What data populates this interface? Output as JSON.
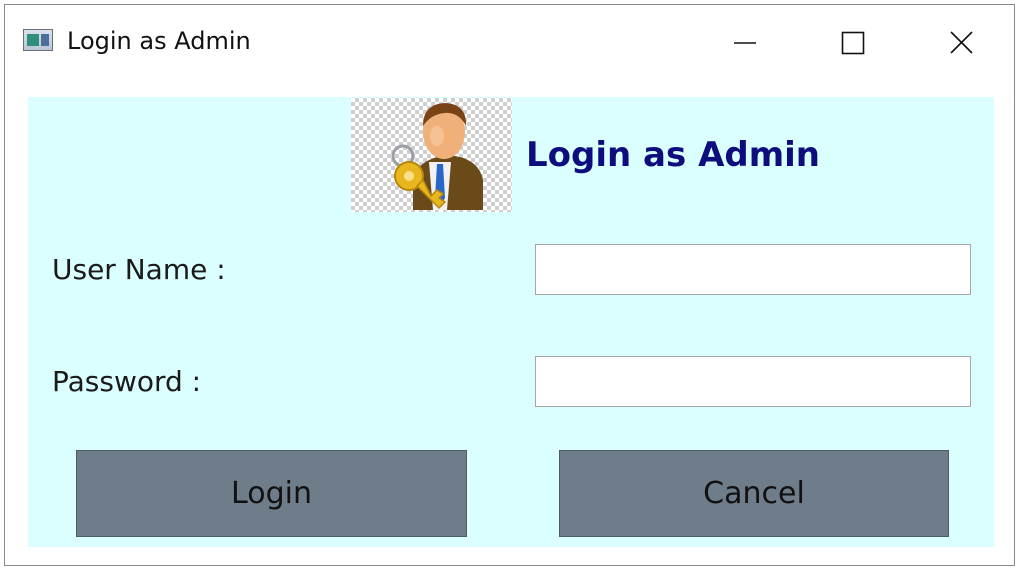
{
  "window": {
    "title": "Login as Admin",
    "icon": "app-window-icon",
    "controls": {
      "minimize": "minimize-icon",
      "maximize": "maximize-icon",
      "close": "close-icon"
    }
  },
  "form": {
    "heading": "Login as Admin",
    "avatar_icon": "admin-key-icon",
    "username": {
      "label": "User Name :",
      "value": "",
      "placeholder": ""
    },
    "password": {
      "label": "Password :",
      "value": "",
      "placeholder": ""
    },
    "buttons": {
      "login": "Login",
      "cancel": "Cancel"
    }
  },
  "colors": {
    "panel_background": "#dbfefe",
    "heading_text": "#0d0d7e",
    "button_background": "#6f7d8b"
  }
}
